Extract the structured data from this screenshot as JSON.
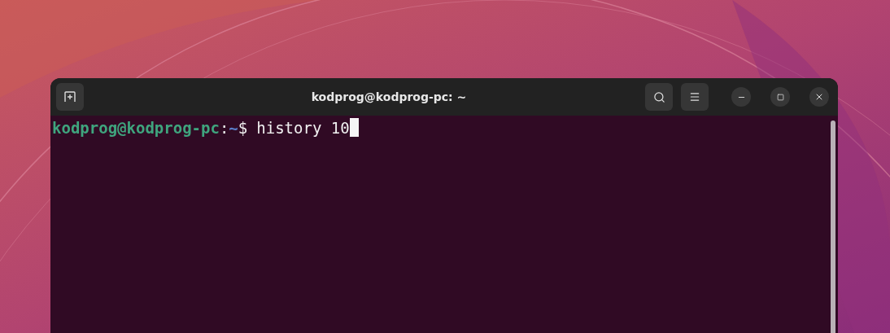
{
  "window": {
    "title": "kodprog@kodprog-pc: ~"
  },
  "terminal": {
    "prompt": {
      "user_host": "kodprog@kodprog-pc",
      "separator": ":",
      "path": "~",
      "symbol": "$"
    },
    "command": "history 10",
    "cursor_visible": true
  }
}
